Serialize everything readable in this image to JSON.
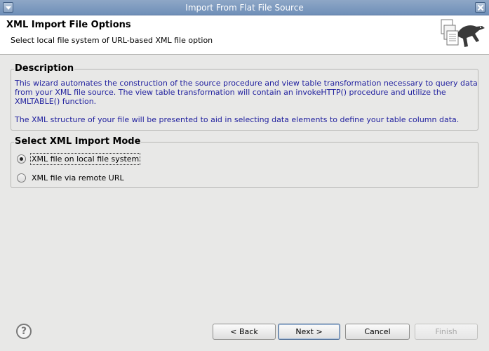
{
  "window": {
    "title": "Import From Flat File Source"
  },
  "banner": {
    "heading": "XML Import File Options",
    "subtitle": "Select local file system of URL-based XML file option",
    "image_icon": "documents-with-lizard-icon"
  },
  "description": {
    "legend": "Description",
    "paragraph1": "This wizard automates the construction of the source procedure and view table transformation necessary to query data from your XML file source. The view table transformation will contain an invokeHTTP() procedure and utilize the XMLTABLE() function.",
    "paragraph2": "The XML structure of your file will be presented to aid in selecting data elements to define your table column data."
  },
  "import_mode": {
    "legend": "Select XML Import Mode",
    "options": [
      {
        "label": "XML file on local file system",
        "selected": true
      },
      {
        "label": "XML file via remote URL",
        "selected": false
      }
    ]
  },
  "buttons": {
    "back": "< Back",
    "next": "Next >",
    "cancel": "Cancel",
    "finish": "Finish",
    "help_icon": "help-icon"
  },
  "colors": {
    "description_text": "#1f1f9e",
    "titlebar": "#7f99bd"
  }
}
